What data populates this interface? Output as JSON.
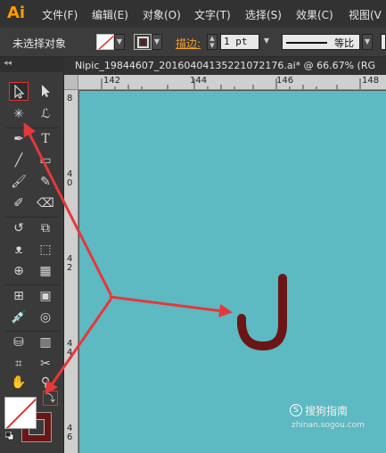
{
  "app": {
    "logo": "Ai"
  },
  "menubar": {
    "items": [
      "文件(F)",
      "编辑(E)",
      "对象(O)",
      "文字(T)",
      "选择(S)",
      "效果(C)",
      "视图(V"
    ]
  },
  "control_bar": {
    "selection_status": "未选择对象",
    "stroke_label": "描边:",
    "stroke_weight": "1 pt",
    "profile_label": "等比"
  },
  "document": {
    "tab_title": "Nipic_19844607_20160404135221072176.ai* @ 66.67% (RG"
  },
  "ruler": {
    "horizontal": [
      "142",
      "144",
      "146",
      "148"
    ],
    "vertical": [
      "8",
      "4\n0",
      "4\n2",
      "4\n4",
      "4\n6"
    ]
  },
  "colors": {
    "canvas": "#5db9c2",
    "annotation_arrow": "#e5383b",
    "hook_stroke": "#6b1616",
    "stroke_swatch": "#6b1616"
  },
  "tools": [
    "selection-tool",
    "direct-selection-tool",
    "magic-wand-tool",
    "lasso-tool",
    "pen-tool",
    "type-tool",
    "line-segment-tool",
    "rectangle-tool",
    "paintbrush-tool",
    "pencil-tool",
    "blob-brush-tool",
    "eraser-tool",
    "rotate-tool",
    "scale-tool",
    "warp-tool",
    "free-transform-tool",
    "shape-builder-tool",
    "perspective-grid-tool",
    "mesh-tool",
    "gradient-tool",
    "eyedropper-tool",
    "blend-tool",
    "symbol-sprayer-tool",
    "column-graph-tool",
    "artboard-tool",
    "slice-tool",
    "hand-tool",
    "zoom-tool"
  ],
  "watermark": {
    "text": "搜狗指南",
    "url": "zhinan.sogou.com"
  }
}
